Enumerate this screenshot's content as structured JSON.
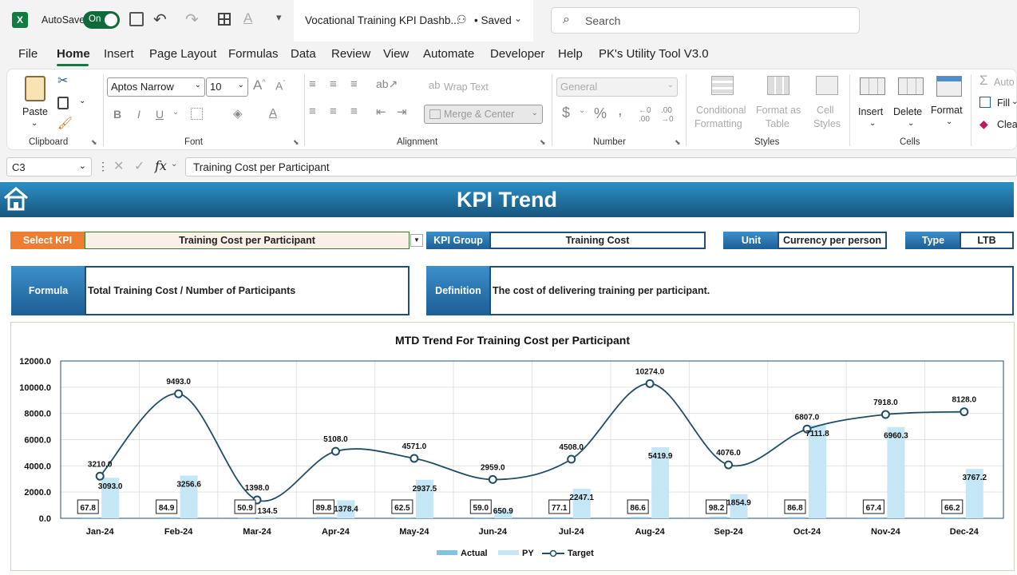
{
  "titlebar": {
    "autosave_label": "AutoSave",
    "autosave_state": "On",
    "doc_title": "Vocational Training KPI Dashb...",
    "saved_status": "• Saved",
    "search_placeholder": "Search"
  },
  "menu": {
    "items": [
      "File",
      "Home",
      "Insert",
      "Page Layout",
      "Formulas",
      "Data",
      "Review",
      "View",
      "Automate",
      "Developer",
      "Help",
      "PK's Utility Tool V3.0"
    ],
    "active": "Home"
  },
  "ribbon": {
    "clipboard": {
      "paste": "Paste",
      "label": "Clipboard"
    },
    "font": {
      "name": "Aptos Narrow",
      "size": "10",
      "label": "Font",
      "bold": "B",
      "italic": "I",
      "underline": "U"
    },
    "alignment": {
      "wrap": "Wrap Text",
      "merge": "Merge & Center",
      "label": "Alignment"
    },
    "number": {
      "format": "General",
      "currency": "$",
      "percent": "%",
      "comma": ",",
      "label": "Number"
    },
    "styles": {
      "conditional": "Conditional",
      "formatting": "Formatting",
      "format_as": "Format as",
      "table": "Table",
      "cell": "Cell",
      "cell_styles": "Styles",
      "label": "Styles"
    },
    "cells": {
      "insert": "Insert",
      "delete": "Delete",
      "format": "Format",
      "label": "Cells"
    },
    "editing": {
      "autosum": "Auto",
      "fill": "Fill",
      "clear": "Clea"
    }
  },
  "formula_bar": {
    "cell_ref": "C3",
    "fx": "fx",
    "content": "Training Cost per Participant"
  },
  "dashboard": {
    "title": "KPI Trend",
    "select_kpi_label": "Select KPI",
    "select_kpi_value": "Training Cost per Participant",
    "kpi_group_label": "KPI Group",
    "kpi_group_value": "Training Cost",
    "unit_label": "Unit",
    "unit_value": "Currency per person",
    "type_label": "Type",
    "type_value": "LTB",
    "formula_label": "Formula",
    "formula_value": "Total Training Cost / Number of Participants",
    "definition_label": "Definition",
    "definition_value": "The cost of delivering training per participant."
  },
  "colors": {
    "accent": "#1f6f9e",
    "select_orange": "#ed7d31",
    "actual": "#7ec3e8",
    "py": "#c5e6f5",
    "target": "#1f4e66"
  },
  "chart_data": {
    "type": "bar",
    "title": "MTD Trend For Training Cost per Participant",
    "categories": [
      "Jan-24",
      "Feb-24",
      "Mar-24",
      "Apr-24",
      "May-24",
      "Jun-24",
      "Jul-24",
      "Aug-24",
      "Sep-24",
      "Oct-24",
      "Nov-24",
      "Dec-24"
    ],
    "series": [
      {
        "name": "Actual",
        "kind": "bar",
        "values": [
          67.8,
          84.9,
          50.9,
          89.8,
          62.5,
          59.0,
          77.1,
          86.6,
          98.2,
          86.8,
          67.4,
          66.2
        ]
      },
      {
        "name": "PY",
        "kind": "bar",
        "values": [
          3093.0,
          3256.6,
          134.5,
          1378.4,
          2937.5,
          650.9,
          2247.1,
          5419.9,
          1854.9,
          7111.8,
          6960.3,
          3767.2
        ]
      },
      {
        "name": "Target",
        "kind": "line",
        "values": [
          3210.0,
          9493.0,
          1398.0,
          5108.0,
          4571.0,
          2959.0,
          4508.0,
          10274.0,
          4076.0,
          6807.0,
          7918.0,
          8128.0
        ]
      }
    ],
    "yticks": [
      "0.0",
      "2000.0",
      "4000.0",
      "6000.0",
      "8000.0",
      "10000.0",
      "12000.0"
    ],
    "ylim": [
      0,
      12000
    ],
    "grid": true,
    "legend": "bottom"
  }
}
